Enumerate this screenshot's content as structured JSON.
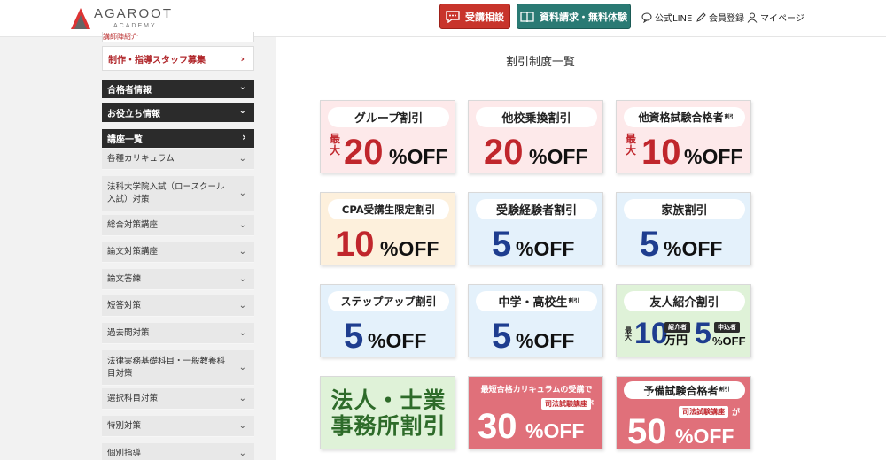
{
  "header": {
    "logo_text": "AGAROOT",
    "logo_sub": "ACADEMY",
    "consult_button": "受講相談",
    "request_button": "資料請求・無料体験",
    "line_link": "公式LINE",
    "register_link": "会員登録",
    "mypage_link": "マイページ"
  },
  "sidebar": {
    "partial_text": "講師陣紹介",
    "recruit_link": "制作・指導スタッフ募集",
    "categories": [
      "合格者情報",
      "お役立ち情報",
      "講座一覧"
    ],
    "items": [
      "各種カリキュラム",
      "法科大学院入試（ロースクール入試）対策",
      "総合対策講座",
      "論文対策講座",
      "論文答練",
      "短答対策",
      "過去問対策",
      "法律実務基礎科目・一般教養科目対策",
      "選択科目対策",
      "特別対策",
      "個別指導"
    ]
  },
  "main": {
    "title": "割引制度一覧",
    "off_text": "%OFF",
    "max_label": "最大",
    "cards": [
      {
        "name": "グループ割引",
        "value": "20",
        "max": true
      },
      {
        "name": "他校乗換割引",
        "value": "20"
      },
      {
        "name": "他資格試験合格者",
        "suffix": "割引",
        "value": "10",
        "max": true
      },
      {
        "name": "CPA受講生限定割引",
        "value": "10"
      },
      {
        "name": "受験経験者割引",
        "value": "5"
      },
      {
        "name": "家族割引",
        "value": "5"
      },
      {
        "name": "ステップアップ割引",
        "value": "5"
      },
      {
        "name": "中学・高校生",
        "suffix": "割引",
        "value": "5"
      },
      {
        "name": "友人紹介割引",
        "referrer_label": "紹介者",
        "referrer_value": "10",
        "referrer_unit": "万円",
        "applicant_label": "申込者",
        "applicant_value": "5"
      },
      {
        "line1": "法人・士業",
        "line2": "事務所割引"
      },
      {
        "headline": "最短合格カリキュラムの受講で",
        "course": "司法試験講座",
        "ga": "が",
        "value": "30"
      },
      {
        "name": "予備試験合格者",
        "suffix": "割引",
        "course": "司法試験講座",
        "ga": "が",
        "value": "50"
      }
    ]
  },
  "colors": {
    "accent_red": "#c8342b",
    "accent_teal": "#2a7a74",
    "discount_red": "#c0262c",
    "discount_blue": "#1e3d8f",
    "sidebar_dark": "#2b2b2b"
  },
  "icons": [
    "logo-triangle-icon",
    "chat-icon",
    "book-icon",
    "line-chat-icon",
    "pencil-icon",
    "person-icon",
    "chevron-right-icon",
    "chevron-down-icon"
  ]
}
